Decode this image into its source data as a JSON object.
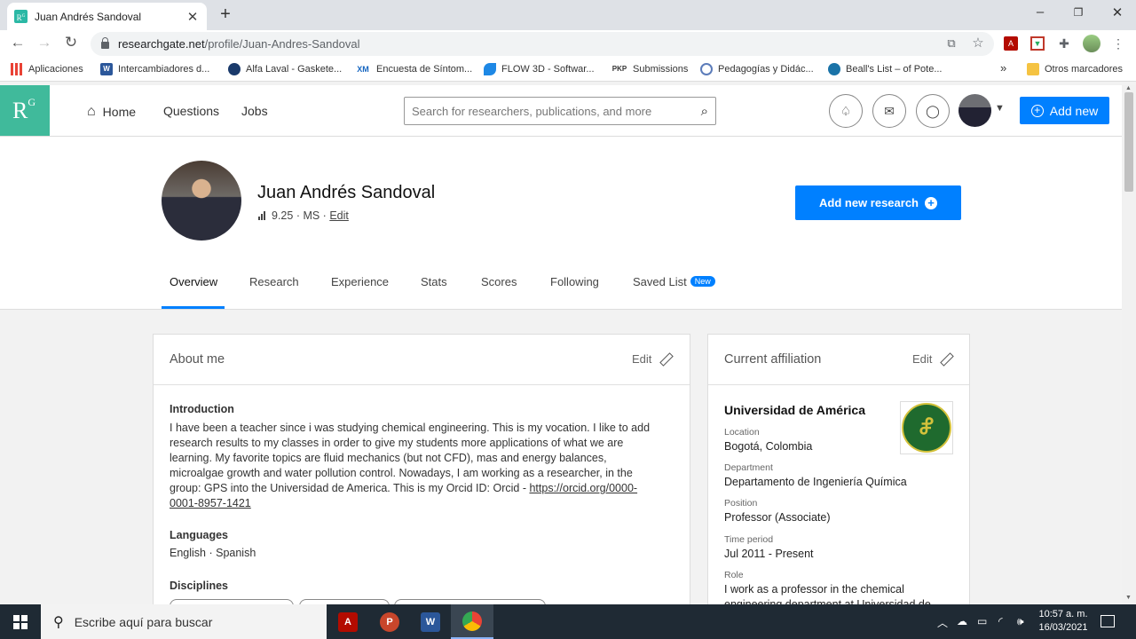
{
  "browser": {
    "tab_title": "Juan Andrés Sandoval",
    "tab_close": "✕",
    "new_tab": "+",
    "url_domain": "researchgate.net",
    "url_path": "/profile/Juan-Andres-Sandoval",
    "window_controls": {
      "minimize": "–",
      "restore": "❐",
      "close": "✕"
    }
  },
  "bookmarks": {
    "apps": "Aplicaciones",
    "items": [
      {
        "label": "Intercambiadores d...",
        "icon": "word-icon"
      },
      {
        "label": "Alfa Laval - Gaskete...",
        "icon": "alfa-laval-icon"
      },
      {
        "label": "Encuesta de Síntom...",
        "icon": "xm-icon"
      },
      {
        "label": "FLOW 3D - Softwar...",
        "icon": "flow3d-icon"
      },
      {
        "label": "Submissions",
        "icon": "pkp-icon"
      },
      {
        "label": "Pedagogías y Didác...",
        "icon": "globe-icon"
      },
      {
        "label": "Beall's List – of Pote...",
        "icon": "globe-icon"
      }
    ],
    "more": "»",
    "other": "Otros marcadores"
  },
  "rg": {
    "logo": "R",
    "logo_sup": "G",
    "nav": {
      "home": "Home",
      "questions": "Questions",
      "jobs": "Jobs"
    },
    "search_placeholder": "Search for researchers, publications, and more",
    "add_new": "Add new"
  },
  "profile": {
    "name": "Juan Andrés Sandoval",
    "score": "9.25",
    "degree": "MS",
    "edit": "Edit",
    "add_research": "Add new research",
    "tabs": [
      "Overview",
      "Research",
      "Experience",
      "Stats",
      "Scores",
      "Following",
      "Saved List"
    ],
    "new_badge": "New"
  },
  "about": {
    "title": "About me",
    "edit": "Edit",
    "intro_heading": "Introduction",
    "intro_lines": [
      "I have been a teacher since i was studying chemical engineering. This is my vocation. I like to add",
      "research results to my classes in order to give my students more applications of what we are",
      "learning. My favorite topics are fluid mechanics (but not CFD), mas and energy balances,",
      "microalgae growth and water pollution control. Nowadays, I am working as a researcher, in the",
      "group: GPS into the Universidad de America. This is my Orcid ID: Orcid - "
    ],
    "orcid_link_1": "https://orcid.org/0000-",
    "orcid_link_2": "0001-8957-1421",
    "languages_heading": "Languages",
    "languages": "English · Spanish",
    "disciplines_heading": "Disciplines"
  },
  "affiliation": {
    "title": "Current affiliation",
    "edit": "Edit",
    "institution": "Universidad de América",
    "location_label": "Location",
    "location": "Bogotá, Colombia",
    "department_label": "Department",
    "department": "Departamento de Ingeniería Química",
    "position_label": "Position",
    "position": "Professor (Associate)",
    "period_label": "Time period",
    "period": "Jul 2011 - Present",
    "role_label": "Role",
    "role_1": "I work as a professor in the chemical",
    "role_2": "engineering department at Universidad de"
  },
  "taskbar": {
    "search_placeholder": "Escribe aquí para buscar",
    "time": "10:57 a. m.",
    "date": "16/03/2021"
  }
}
